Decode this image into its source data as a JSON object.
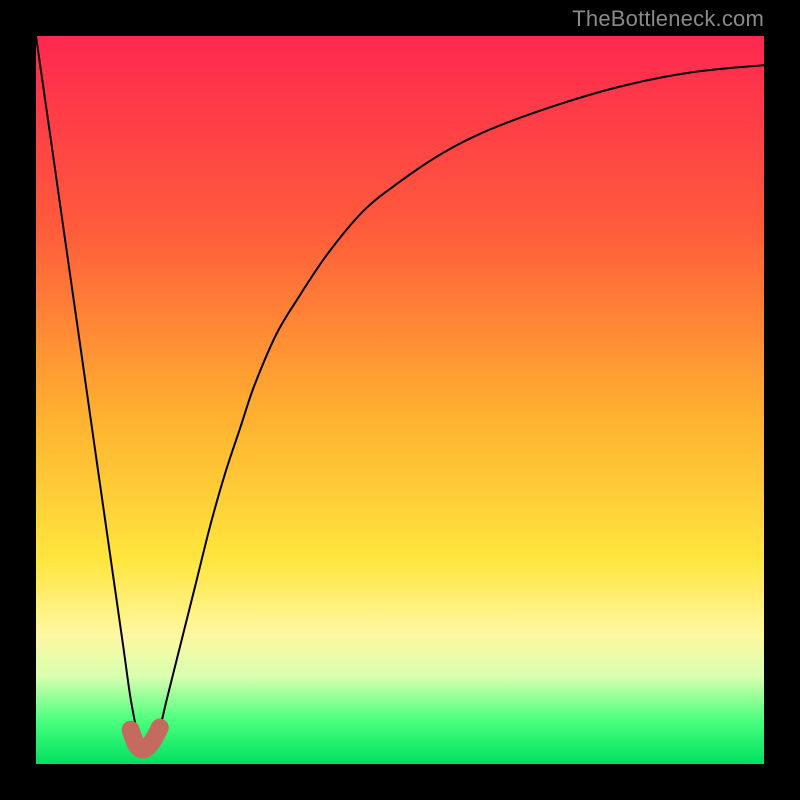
{
  "watermark": "TheBottleneck.com",
  "colors": {
    "frame": "#000000",
    "curve": "#000000",
    "accent": "#c46a5e",
    "gradient_stops": [
      "#ff2850",
      "#ff5a3c",
      "#ffb030",
      "#ffe63e",
      "#fff7a0",
      "#d8ffb0",
      "#4bff7e",
      "#00e060"
    ]
  },
  "chart_data": {
    "type": "line",
    "title": "",
    "xlabel": "",
    "ylabel": "",
    "xlim": [
      0,
      100
    ],
    "ylim": [
      0,
      100
    ],
    "grid": false,
    "series": [
      {
        "name": "bottleneck-curve",
        "x": [
          0,
          2,
          4,
          6,
          8,
          10,
          12,
          13,
          14,
          15,
          16,
          17,
          18,
          20,
          22,
          24,
          26,
          28,
          30,
          33,
          36,
          40,
          45,
          50,
          56,
          62,
          70,
          80,
          90,
          100
        ],
        "values": [
          100,
          86,
          72,
          58,
          44,
          30,
          16,
          9,
          4,
          2,
          3,
          5,
          9,
          17,
          25,
          33,
          40,
          46,
          52,
          59,
          64,
          70,
          76,
          80,
          84,
          87,
          90,
          93,
          95,
          96
        ]
      },
      {
        "name": "optimal-marker",
        "x": [
          13.0,
          13.7,
          14.5,
          15.3,
          16.1,
          17.0
        ],
        "values": [
          4.7,
          2.8,
          2.0,
          2.3,
          3.3,
          5.0
        ]
      }
    ],
    "legend": {
      "visible": false
    }
  }
}
